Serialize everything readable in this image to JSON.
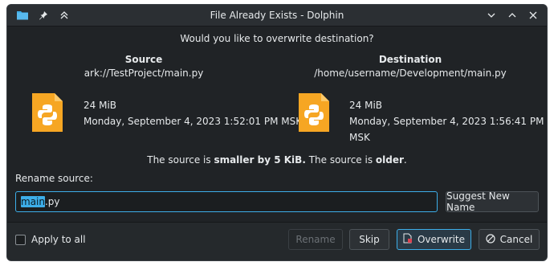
{
  "window": {
    "title": "File Already Exists - Dolphin",
    "icons": [
      "folder-icon",
      "pin-icon",
      "keep-above-icon",
      "minimize-icon",
      "maximize-icon",
      "close-icon"
    ]
  },
  "dialog": {
    "question": "Would you like to overwrite destination?",
    "source": {
      "heading": "Source",
      "path": "ark://TestProject/main.py",
      "size": "24 MiB",
      "modified": "Monday, September 4, 2023 1:52:01 PM MSK"
    },
    "destination": {
      "heading": "Destination",
      "path": "/home/username/Development/main.py",
      "size": "24 MiB",
      "modified": "Monday, September 4, 2023 1:56:41 PM MSK"
    },
    "comparison": {
      "p1": "The source is ",
      "b1": "smaller by 5 KiB.",
      "p2": " The source is ",
      "b2": "older",
      "p3": "."
    },
    "rename_label": "Rename source:",
    "rename_value_selected": "main",
    "rename_value_rest": ".py",
    "suggest_button": "Suggest New Name",
    "apply_to_all": "Apply to all",
    "buttons": {
      "rename": "Rename",
      "skip": "Skip",
      "overwrite": "Overwrite",
      "cancel": "Cancel"
    }
  },
  "colors": {
    "accent": "#3daee9",
    "file_icon": "#f6a623",
    "background": "#202326"
  }
}
